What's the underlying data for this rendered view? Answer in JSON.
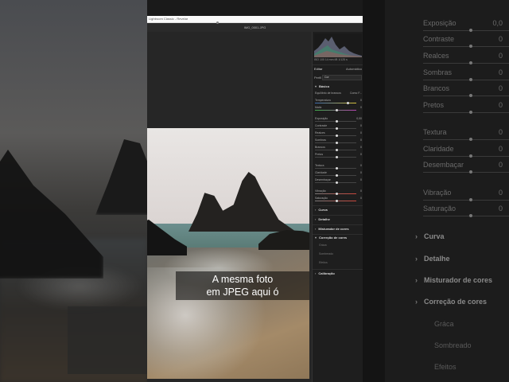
{
  "window": {
    "title_strip": "Lightroom Classic - Revelar",
    "file_name": "IMG_0001.JPG"
  },
  "caption": {
    "line1": "A mesma foto",
    "line2": "em JPEG aqui ó"
  },
  "panel": {
    "meta": "ISO 100   14 mm   f/8   1/125 s",
    "edit_label": "Editar",
    "edit_mode": "Automático",
    "profile_label": "Perfil",
    "profile_value": "Cor",
    "basic_section": "Básico",
    "sliders_wb": [
      {
        "label": "Equilíbrio de brancos",
        "value": "Como F..."
      },
      {
        "label": "Temperatura",
        "value": "0"
      },
      {
        "label": "Matiz",
        "value": "0"
      }
    ],
    "sliders_tone": [
      {
        "label": "Exposição",
        "value": "0,00"
      },
      {
        "label": "Contraste",
        "value": "0"
      },
      {
        "label": "Realces",
        "value": "0"
      },
      {
        "label": "Sombras",
        "value": "0"
      },
      {
        "label": "Brancos",
        "value": "0"
      },
      {
        "label": "Pretos",
        "value": "0"
      }
    ],
    "sliders_presence": [
      {
        "label": "Textura",
        "value": "0"
      },
      {
        "label": "Claridade",
        "value": "0"
      },
      {
        "label": "Desembaçar",
        "value": "0"
      }
    ],
    "sliders_color": [
      {
        "label": "Vibração",
        "value": "0"
      },
      {
        "label": "Saturação",
        "value": "0"
      }
    ],
    "sections": [
      "Curva",
      "Detalhe",
      "Misturador de cores",
      "Correção de cores"
    ],
    "color_grading_subs": [
      "Gráca",
      "Sombreado",
      "Efeitos"
    ],
    "calibration": "Calibração"
  },
  "ghost": {
    "rows": [
      {
        "label": "Exposição",
        "value": "0,0"
      },
      {
        "label": "Contraste",
        "value": "0"
      },
      {
        "label": "Realces",
        "value": "0"
      },
      {
        "label": "Sombras",
        "value": "0"
      },
      {
        "label": "Brancos",
        "value": "0"
      },
      {
        "label": "Pretos",
        "value": "0"
      },
      {
        "label": "Textura",
        "value": "0"
      },
      {
        "label": "Claridade",
        "value": "0"
      },
      {
        "label": "Desembaçar",
        "value": "0"
      },
      {
        "label": "Vibração",
        "value": "0"
      },
      {
        "label": "Saturação",
        "value": "0"
      }
    ],
    "sections": [
      "Curva",
      "Detalhe",
      "Misturador de cores",
      "Correção de cores"
    ],
    "subs": [
      "Gráca",
      "Sombreado",
      "Efeitos"
    ]
  }
}
